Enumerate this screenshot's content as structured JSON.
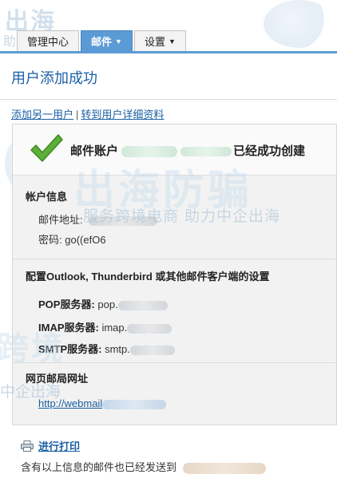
{
  "watermark": {
    "top_left_brand": "出海",
    "top_left_slogan": "助力中企出海",
    "center_brand": "出海防骗",
    "center_slogan": "服务跨境电商  助力中企出海",
    "bottom_left_slogan": "中企出海",
    "bottom_left_brand": "跨境"
  },
  "nav": {
    "tabs": [
      {
        "label": "管理中心"
      },
      {
        "label": "邮件"
      },
      {
        "label": "设置"
      }
    ]
  },
  "page": {
    "title": "用户添加成功"
  },
  "links": {
    "add_another": "添加另一用户",
    "separator": "|",
    "goto_details": "转到用户详细资料"
  },
  "success": {
    "prefix": "邮件账户",
    "suffix": "已经成功创建"
  },
  "account": {
    "section_title": "帐户信息",
    "email_label": "邮件地址:",
    "password_label": "密码:",
    "password_value": "go((efO6"
  },
  "client": {
    "section_title": "配置Outlook, Thunderbird 或其他邮件客户端的设置",
    "pop_label": "POP服务器:",
    "pop_value": "pop.",
    "imap_label": "IMAP服务器:",
    "imap_value": "imap.",
    "smtp_label": "SMTP服务器:",
    "smtp_value": "smtp."
  },
  "webmail": {
    "section_title": "网页邮局网址",
    "url": "http://webmail"
  },
  "print": {
    "label": "进行打印"
  },
  "footer": {
    "text": "含有以上信息的邮件也已经发送到"
  }
}
